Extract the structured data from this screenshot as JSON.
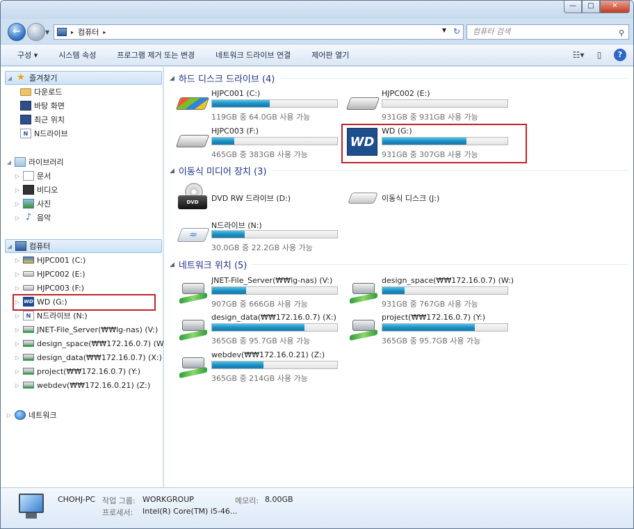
{
  "window": {
    "buttons": {
      "minimize": "—",
      "maximize": "□",
      "close": "✕"
    }
  },
  "address": {
    "crumb_root_arrow": "▸",
    "location": "컴퓨터",
    "crumb_arrow": "▸",
    "search_placeholder": "컴퓨터 검색"
  },
  "toolbar": {
    "items": [
      "구성 ▾",
      "시스템 속성",
      "프로그램 제거 또는 변경",
      "네트워크 드라이브 연결",
      "제어판 열기"
    ]
  },
  "nav": {
    "favorites": {
      "label": "즐겨찾기",
      "items": [
        "다운로드",
        "바탕 화면",
        "최근 위치",
        "N드라이브"
      ]
    },
    "libraries": {
      "label": "라이브러리",
      "items": [
        "문서",
        "비디오",
        "사진",
        "음악"
      ]
    },
    "computer": {
      "label": "컴퓨터",
      "items": [
        "HJPC001 (C:)",
        "HJPC002 (E:)",
        "HJPC003 (F:)",
        "WD (G:)",
        "N드라이브 (N:)",
        "JNET-File_Server(₩₩lg-nas) (V:)",
        "design_space(₩₩172.16.0.7) (W:)",
        "design_data(₩₩172.16.0.7) (X:)",
        "project(₩₩172.16.0.7) (Y:)",
        "webdev(₩₩172.16.0.21) (Z:)"
      ]
    },
    "network": {
      "label": "네트워크"
    }
  },
  "content": {
    "hdd_section": "하드 디스크 드라이브 (4)",
    "removable_section": "이동식 미디어 장치 (3)",
    "network_section": "네트워크 위치 (5)",
    "hdd": [
      {
        "name": "HJPC001 (C:)",
        "free": "119GB 중 64.0GB 사용 가능",
        "used_fraction": 0.46
      },
      {
        "name": "HJPC002 (E:)",
        "free": "931GB 중 931GB 사용 가능",
        "used_fraction": 0.0
      },
      {
        "name": "HJPC003 (F:)",
        "free": "465GB 중 383GB 사용 가능",
        "used_fraction": 0.18
      },
      {
        "name": "WD (G:)",
        "free": "931GB 중 307GB 사용 가능",
        "used_fraction": 0.67
      }
    ],
    "removable": [
      {
        "name": "DVD RW 드라이브 (D:)"
      },
      {
        "name": "이동식 디스크 (J:)"
      },
      {
        "name": "N드라이브 (N:)",
        "free": "30.0GB 중 22.2GB 사용 가능",
        "used_fraction": 0.26
      }
    ],
    "dvd_label": "DVD",
    "wd_logo": "WD",
    "network": [
      {
        "name": "JNET-File_Server(₩₩lg-nas) (V:)",
        "free": "907GB 중 666GB 사용 가능",
        "used_fraction": 0.27
      },
      {
        "name": "design_space(₩₩172.16.0.7) (W:)",
        "free": "931GB 중 767GB 사용 가능",
        "used_fraction": 0.18
      },
      {
        "name": "design_data(₩₩172.16.0.7) (X:)",
        "free": "365GB 중 95.7GB 사용 가능",
        "used_fraction": 0.74
      },
      {
        "name": "project(₩₩172.16.0.7) (Y:)",
        "free": "365GB 중 95.7GB 사용 가능",
        "used_fraction": 0.74
      },
      {
        "name": "webdev(₩₩172.16.0.21) (Z:)",
        "free": "365GB 중 214GB 사용 가능",
        "used_fraction": 0.41
      }
    ]
  },
  "details": {
    "pc_name": "CHOHJ-PC",
    "workgroup_label": "작업 그룹:",
    "workgroup": "WORKGROUP",
    "memory_label": "메모리:",
    "memory": "8.00GB",
    "processor_label": "프로세서:",
    "processor": "Intel(R) Core(TM) i5-46..."
  },
  "icons": {
    "back": "←",
    "search": "⚲",
    "star": "★",
    "help": "?",
    "refresh": "↻"
  }
}
